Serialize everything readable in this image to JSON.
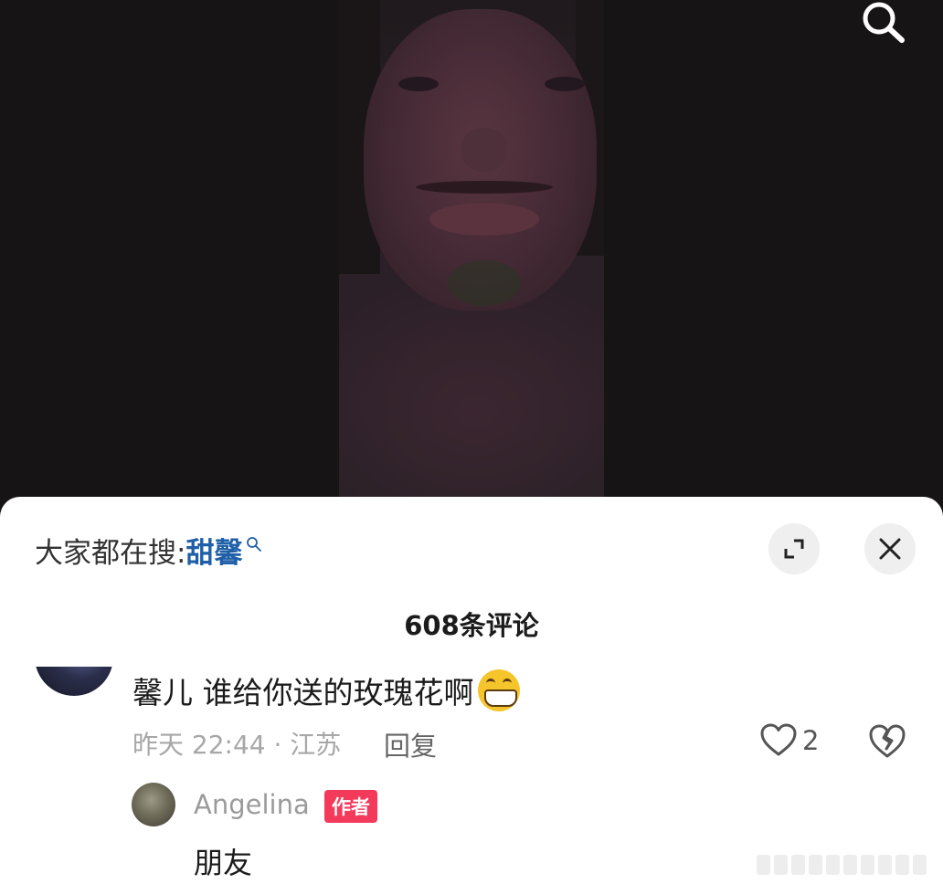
{
  "video": {
    "description_icon": "search-icon"
  },
  "sheet": {
    "hot_search_prefix": "大家都在搜:",
    "hot_search_term": "甜馨",
    "comment_count_label": "608条评论",
    "icons": {
      "expand": "expand-icon",
      "close": "close-icon",
      "like": "heart-icon",
      "dislike": "broken-heart-icon"
    }
  },
  "comments": [
    {
      "text": "馨儿 谁给你送的玫瑰花啊",
      "emoji": "grinning-face-emoji",
      "meta": "昨天 22:44 · 江苏",
      "reply_label": "回复",
      "likes": "2",
      "replies": [
        {
          "username": "Angelina",
          "tag": "作者",
          "text": "朋友"
        }
      ]
    }
  ],
  "colors": {
    "author_tag": "#f33a5b",
    "hot_search_term": "#1f5fa8",
    "sheet_bg": "#ffffff",
    "video_bg": "#161415"
  }
}
